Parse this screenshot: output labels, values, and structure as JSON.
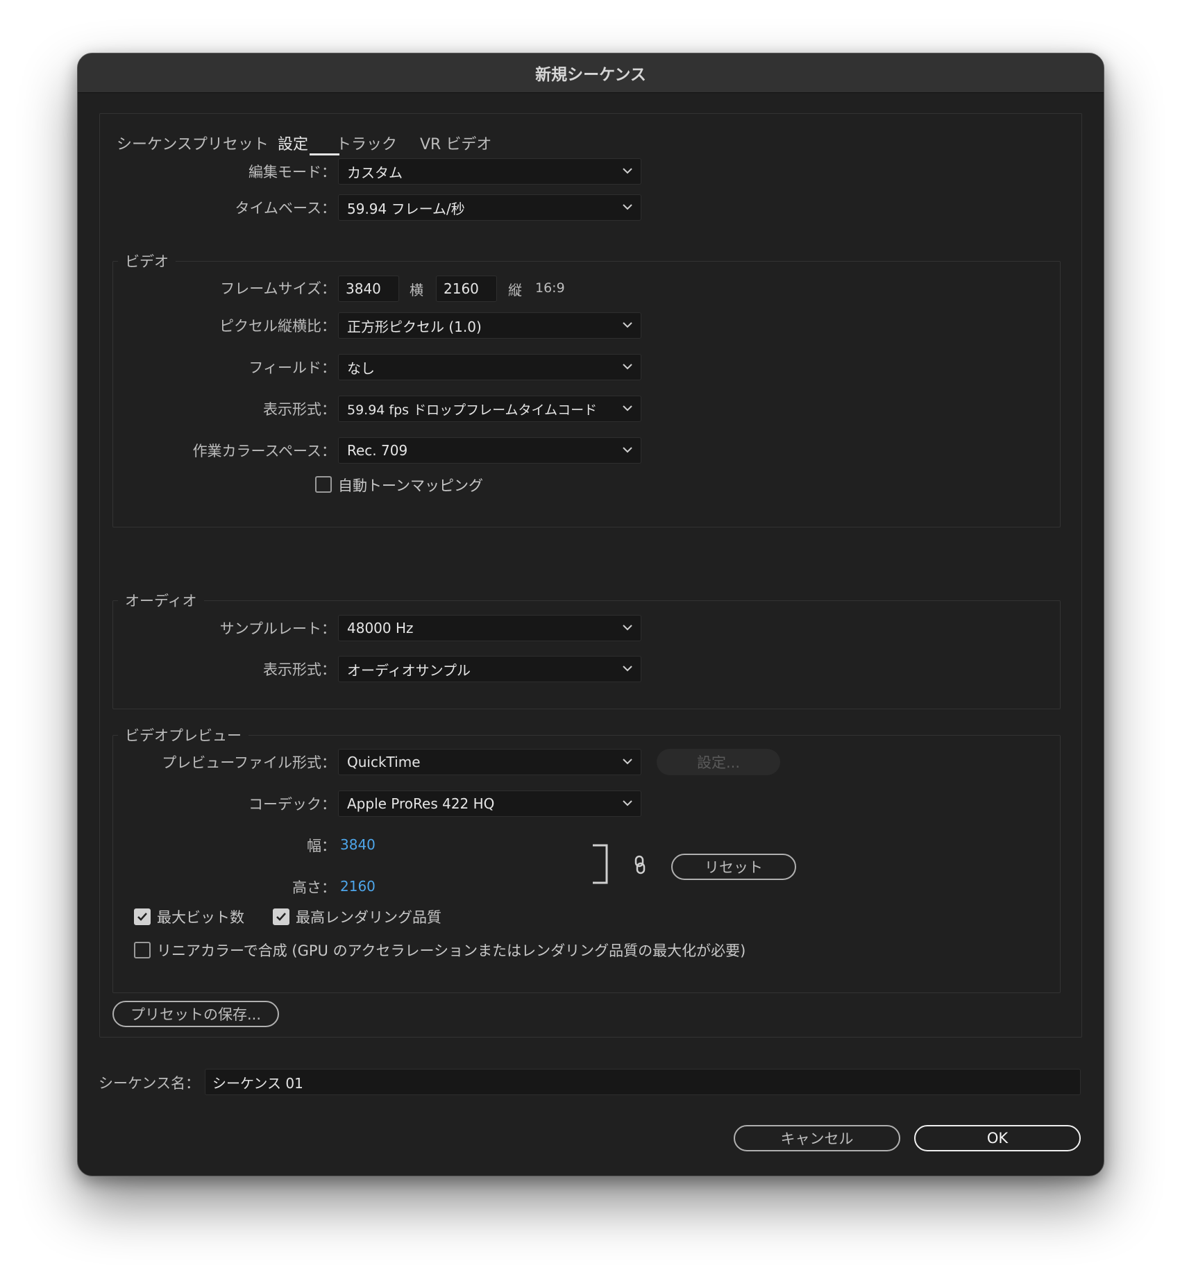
{
  "window": {
    "title": "新規シーケンス"
  },
  "tabs": [
    {
      "label": "シーケンスプリセット"
    },
    {
      "label": "設定"
    },
    {
      "label": "トラック"
    },
    {
      "label": "VR ビデオ"
    }
  ],
  "active_tab": "設定",
  "general": {
    "edit_mode": {
      "label": "編集モード：",
      "value": "カスタム"
    },
    "timebase": {
      "label": "タイムベース：",
      "value": "59.94  フレーム/秒"
    }
  },
  "video": {
    "title": "ビデオ",
    "frame_size": {
      "label": "フレームサイズ：",
      "width": "3840",
      "width_unit": "横",
      "height": "2160",
      "height_unit": "縦",
      "aspect": "16:9"
    },
    "pixel_aspect": {
      "label": "ピクセル縦横比：",
      "value": "正方形ピクセル (1.0)"
    },
    "fields": {
      "label": "フィールド：",
      "value": "なし"
    },
    "display_format": {
      "label": "表示形式：",
      "value": "59.94 fps ドロップフレームタイムコード"
    },
    "color_space": {
      "label": "作業カラースペース：",
      "value": "Rec. 709"
    },
    "auto_tone_mapping": {
      "label": "自動トーンマッピング",
      "checked": false
    }
  },
  "audio": {
    "title": "オーディオ",
    "sample_rate": {
      "label": "サンプルレート：",
      "value": "48000 Hz"
    },
    "display_format": {
      "label": "表示形式：",
      "value": "オーディオサンプル"
    }
  },
  "video_preview": {
    "title": "ビデオプレビュー",
    "file_format": {
      "label": "プレビューファイル形式：",
      "value": "QuickTime",
      "settings_button": "設定..."
    },
    "codec": {
      "label": "コーデック：",
      "value": "Apple ProRes 422 HQ"
    },
    "width": {
      "label": "幅：",
      "value": "3840"
    },
    "height": {
      "label": "高さ：",
      "value": "2160"
    },
    "reset_button": "リセット",
    "max_bit_depth": {
      "label": "最大ビット数",
      "checked": true
    },
    "max_render_quality": {
      "label": "最高レンダリング品質",
      "checked": true
    },
    "linear_color": {
      "label": "リニアカラーで合成 (GPU のアクセラレーションまたはレンダリング品質の最大化が必要)",
      "checked": false
    }
  },
  "save_preset_button": "プリセットの保存...",
  "sequence_name": {
    "label": "シーケンス名：",
    "value": "シーケンス 01"
  },
  "buttons": {
    "cancel": "キャンセル",
    "ok": "OK"
  },
  "colors": {
    "background": "#202020",
    "link": "#4ea6ea",
    "titlebar": "#323232"
  }
}
